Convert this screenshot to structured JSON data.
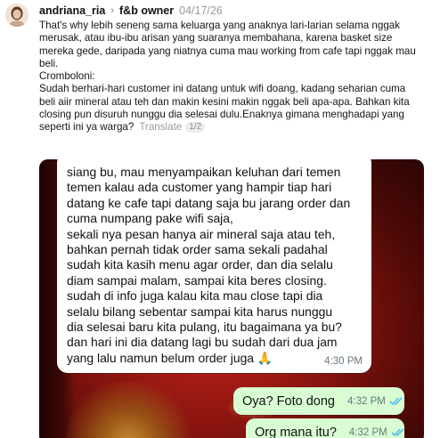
{
  "post": {
    "username": "andriana_ria",
    "topic": "f&b owner",
    "date": "04/17/26",
    "paragraphs": [
      "That's why lebih seneng sama keluarga yang anaknya lari-larian selama nggak merusak, atau ibu-ibu arisan yang suaranya membahana, karena basket size mereka gede, daripada yang niatnya cuma mau working from cafe tapi nggak mau beli.",
      "Cromboloni:",
      "Sudah berhari-hari customer ini datang untuk wifi doang, kadang seharian cuma beli aiir mineral atau teh dan makin kesini makin nggak beli apa-apa. Bahkan kita closing pun disuruh nunggu dia selesai dulu.Enaknya gimana menghadapi yang seperti ini ya warga?"
    ],
    "translate_label": "Translate",
    "page_indicator": "1/2"
  },
  "chat": {
    "incoming_text": "siang bu, mau menyampaikan keluhan dari temen\ntemen kalau ada customer yang hampir tiap hari\ndatang ke cafe tapi datang saja bu jarang order dan\ncuma numpang pake wifi saja,\nsekali nya pesan hanya air mineral saja atau teh,\nbahkan pernah tidak order sama sekali padahal\nsudah kita kasih menu agar order, dan dia selalu\ndiam sampai malam, sampai kita beres closing.\nsudah di info juga kalau kita mau close tapi dia\nselalu bilang sebentar sampai kita harus nunggu\ndia selesai baru kita pulang, itu bagaimana ya bu?\ndan hari ini dia datang lagi bu sudah dari dua jam\nyang lalu namun belum order juga",
    "incoming_emoji": "🙏",
    "incoming_time": "4:30 PM",
    "outgoing": [
      {
        "text": "Oya? Foto dong",
        "time": "4:32 PM"
      },
      {
        "text": "Org mana itu?",
        "time": "4:32 PM"
      }
    ],
    "colors": {
      "incoming_bg": "#ffffff",
      "outgoing_bg": "#d9fdd3",
      "read_ticks": "#53bdeb",
      "time": "#667781"
    }
  }
}
